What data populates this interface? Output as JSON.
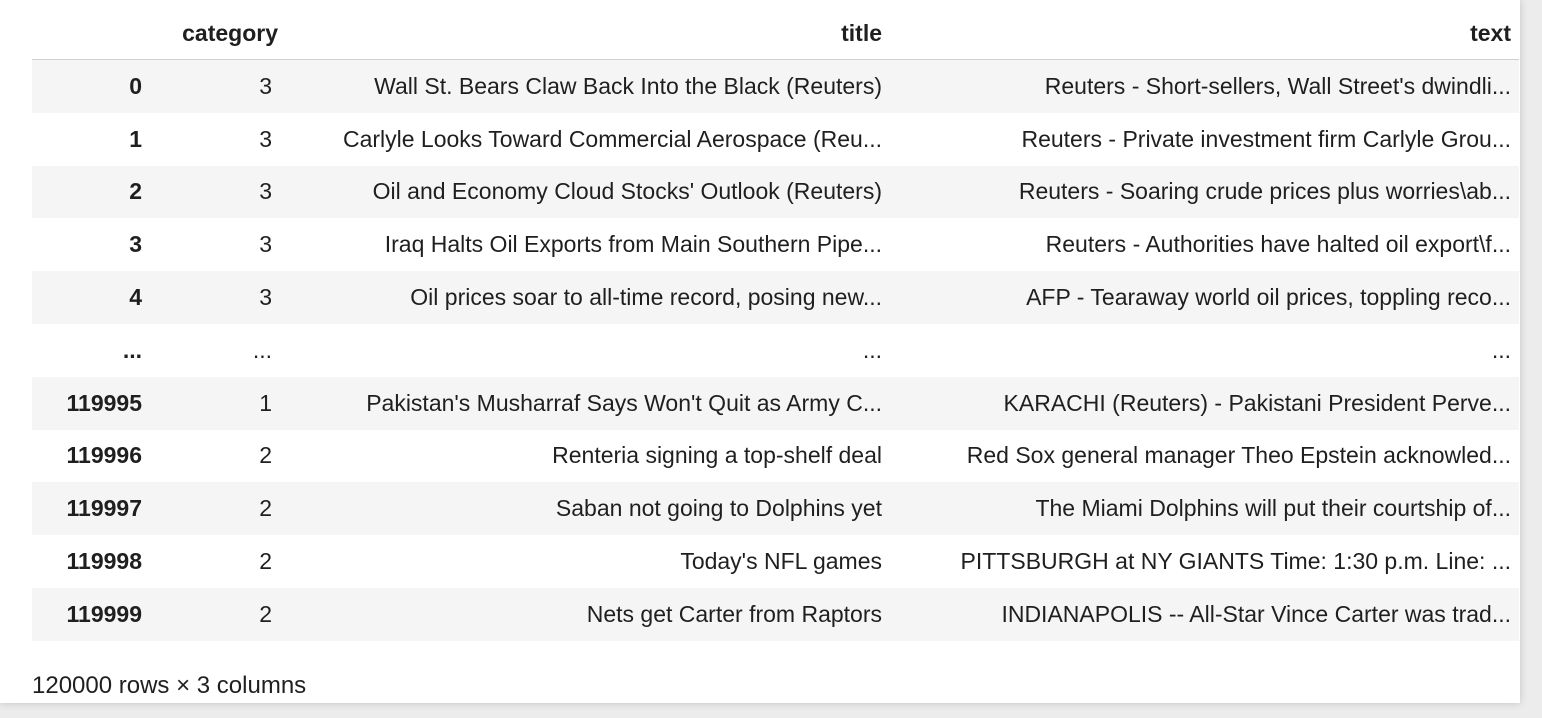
{
  "columns": {
    "index": "",
    "category": "category",
    "title": "title",
    "text": "text"
  },
  "rows": [
    {
      "index": "0",
      "category": "3",
      "title": "Wall St. Bears Claw Back Into the Black (Reuters)",
      "text": "Reuters - Short-sellers, Wall Street's dwindli..."
    },
    {
      "index": "1",
      "category": "3",
      "title": "Carlyle Looks Toward Commercial Aerospace (Reu...",
      "text": "Reuters - Private investment firm Carlyle Grou..."
    },
    {
      "index": "2",
      "category": "3",
      "title": "Oil and Economy Cloud Stocks' Outlook (Reuters)",
      "text": "Reuters - Soaring crude prices plus worries\\ab..."
    },
    {
      "index": "3",
      "category": "3",
      "title": "Iraq Halts Oil Exports from Main Southern Pipe...",
      "text": "Reuters - Authorities have halted oil export\\f..."
    },
    {
      "index": "4",
      "category": "3",
      "title": "Oil prices soar to all-time record, posing new...",
      "text": "AFP - Tearaway world oil prices, toppling reco..."
    },
    {
      "index": "...",
      "category": "...",
      "title": "...",
      "text": "..."
    },
    {
      "index": "119995",
      "category": "1",
      "title": "Pakistan's Musharraf Says Won't Quit as Army C...",
      "text": "KARACHI (Reuters) - Pakistani President Perve..."
    },
    {
      "index": "119996",
      "category": "2",
      "title": "Renteria signing a top-shelf deal",
      "text": "Red Sox general manager Theo Epstein acknowled..."
    },
    {
      "index": "119997",
      "category": "2",
      "title": "Saban not going to Dolphins yet",
      "text": "The Miami Dolphins will put their courtship of..."
    },
    {
      "index": "119998",
      "category": "2",
      "title": "Today's NFL games",
      "text": "PITTSBURGH at NY GIANTS Time: 1:30 p.m. Line: ..."
    },
    {
      "index": "119999",
      "category": "2",
      "title": "Nets get Carter from Raptors",
      "text": "INDIANAPOLIS -- All-Star Vince Carter was trad..."
    }
  ],
  "summary": "120000 rows × 3 columns"
}
